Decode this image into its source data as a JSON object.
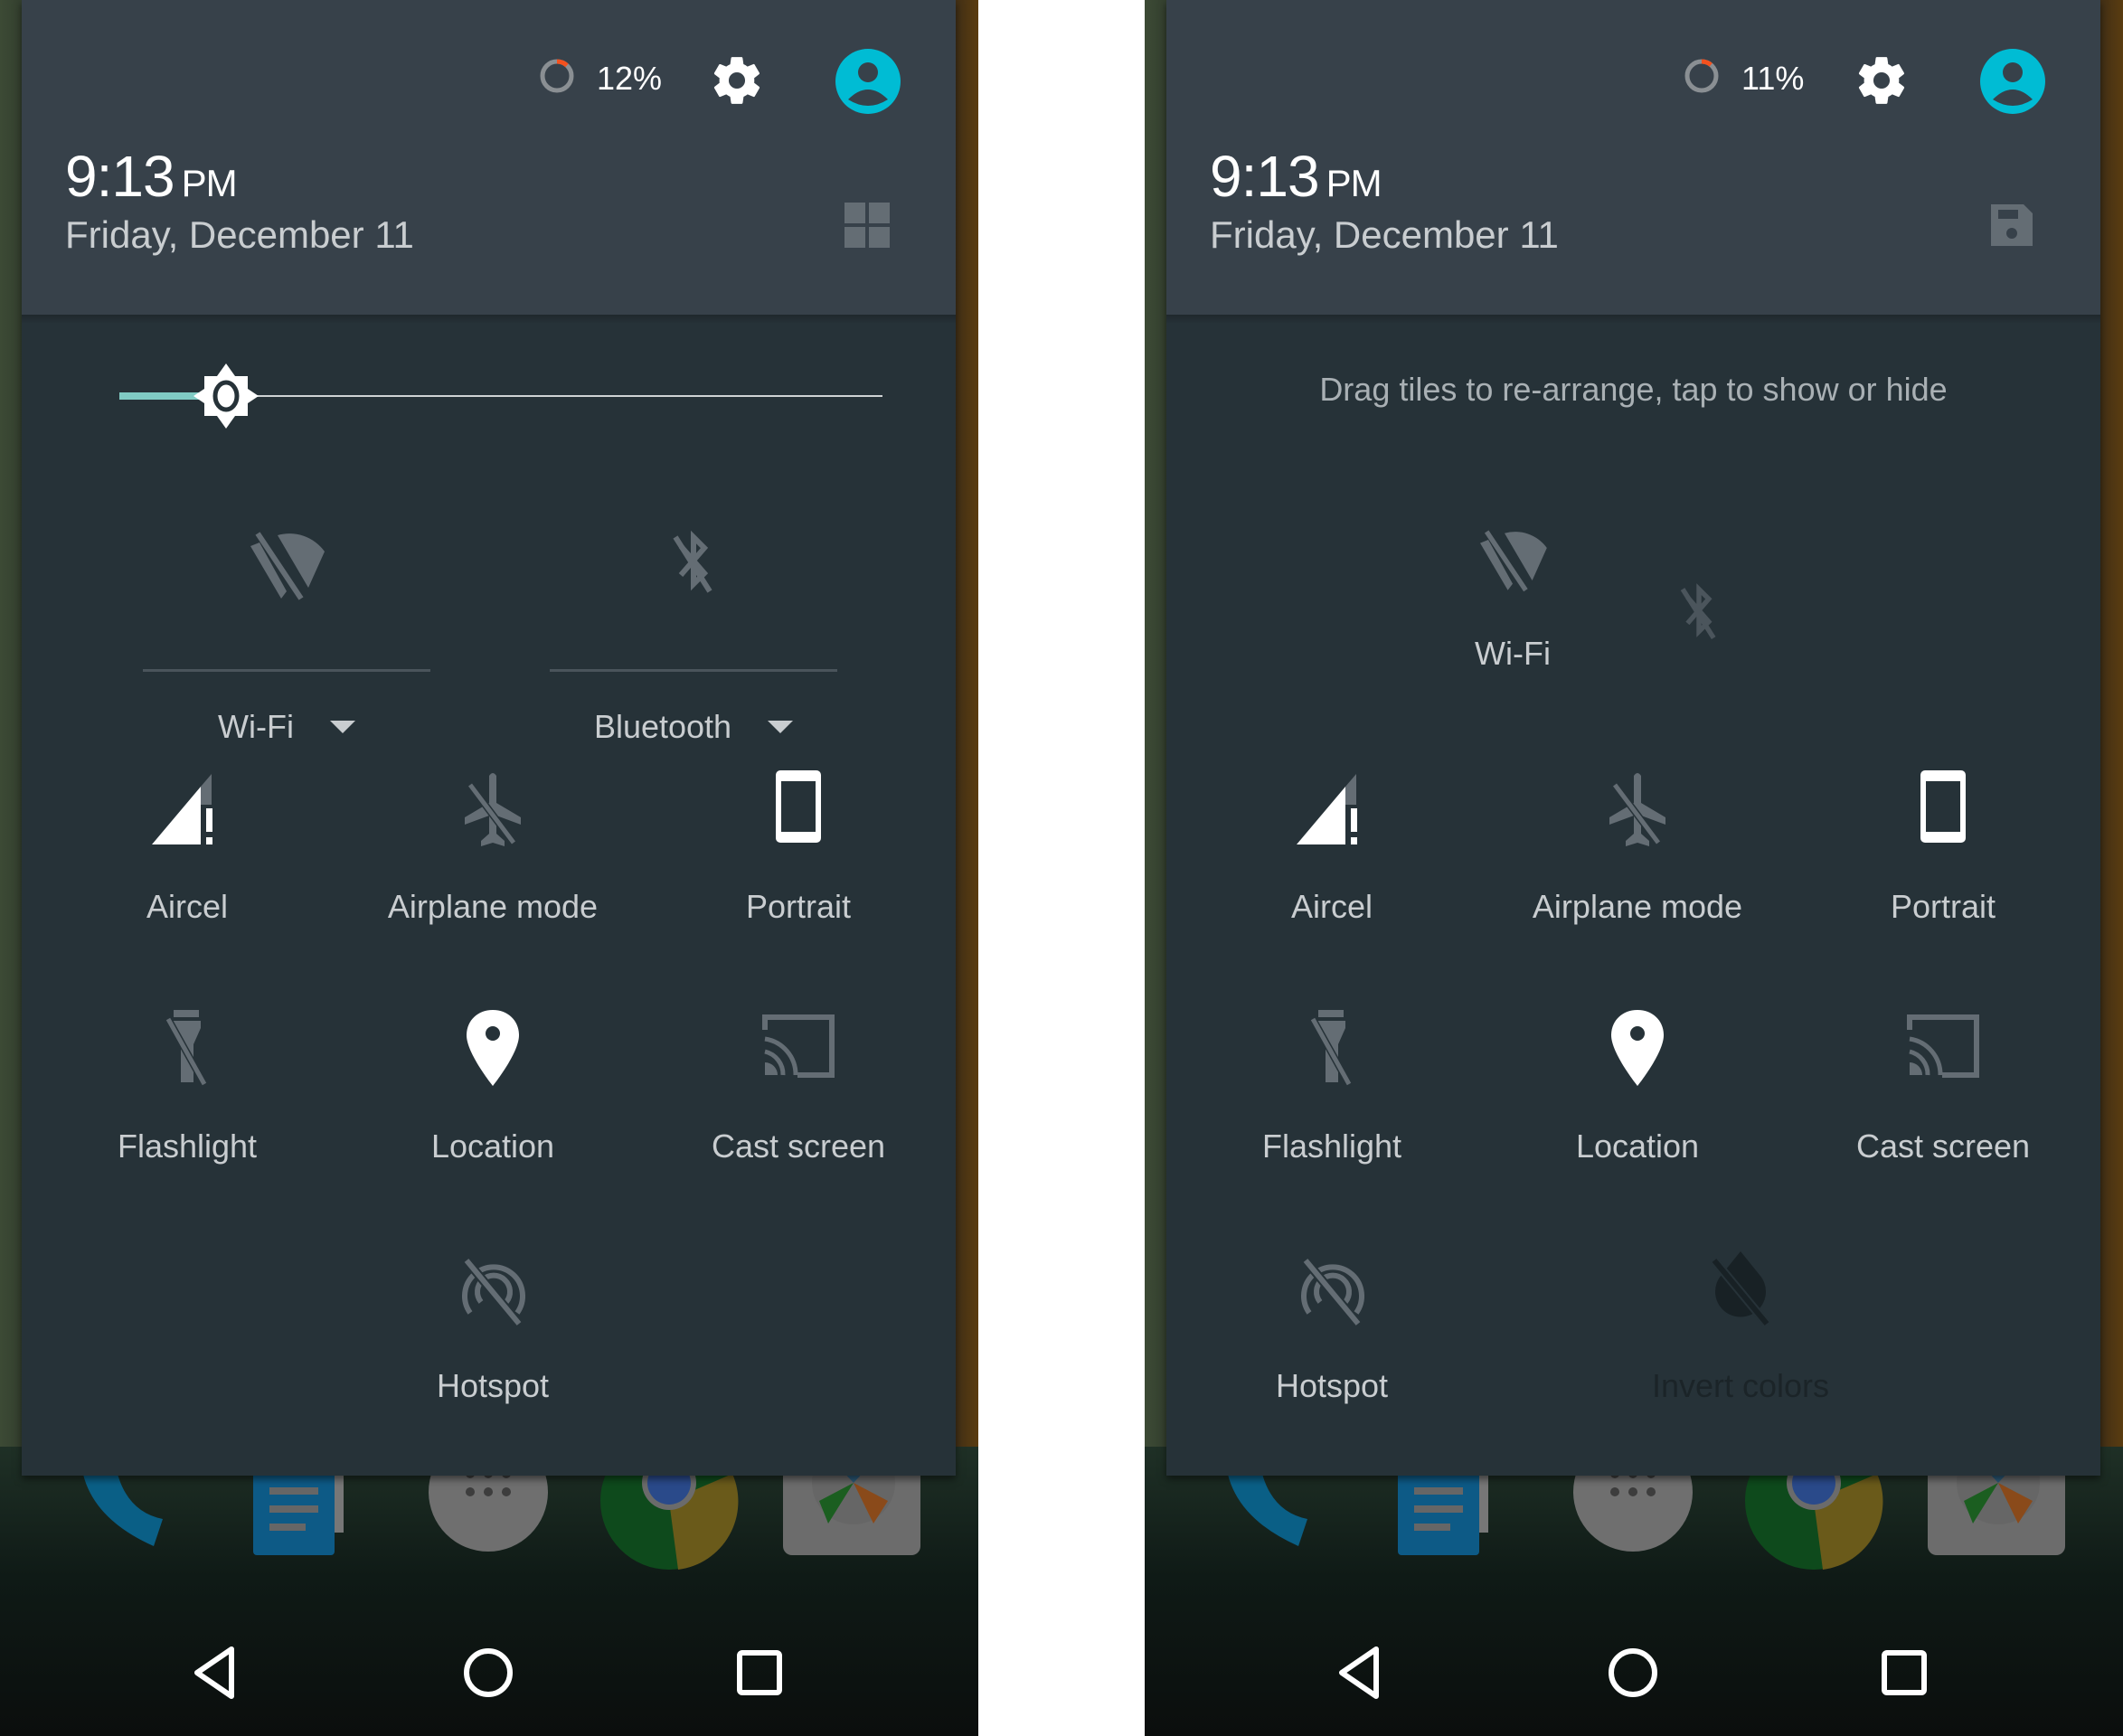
{
  "screens": [
    {
      "id": "left",
      "mode": "normal",
      "battery": {
        "percent_label": "12%",
        "level": 0.12
      },
      "time": {
        "value": "9:13",
        "ampm": "PM"
      },
      "date": "Friday, December 11",
      "header_action_icon": "grid-icon",
      "brightness": {
        "level": 0.14
      },
      "expandable_tiles": [
        {
          "label": "Wi-Fi",
          "icon": "wifi-off-icon"
        },
        {
          "label": "Bluetooth",
          "icon": "bluetooth-off-icon"
        }
      ],
      "tiles": [
        {
          "label": "Aircel",
          "icon": "signal-alert-icon",
          "active": true
        },
        {
          "label": "Airplane mode",
          "icon": "airplane-off-icon",
          "active": false
        },
        {
          "label": "Portrait",
          "icon": "portrait-icon",
          "active": true
        },
        {
          "label": "Flashlight",
          "icon": "flashlight-off-icon",
          "active": false
        },
        {
          "label": "Location",
          "icon": "location-icon",
          "active": true
        },
        {
          "label": "Cast screen",
          "icon": "cast-icon",
          "active": false
        },
        {
          "label": "Hotspot",
          "icon": "hotspot-off-icon",
          "active": false
        }
      ]
    },
    {
      "id": "right",
      "mode": "edit",
      "battery": {
        "percent_label": "11%",
        "level": 0.11
      },
      "time": {
        "value": "9:13",
        "ampm": "PM"
      },
      "date": "Friday, December 11",
      "header_action_icon": "save-icon",
      "hint": "Drag tiles to re-arrange, tap to show or hide",
      "tiles": [
        {
          "label": "Wi-Fi",
          "icon": "wifi-off-icon",
          "active": false
        },
        {
          "label": "",
          "icon": "bluetooth-off-icon",
          "active": false,
          "dragging": true
        },
        {
          "label": "Aircel",
          "icon": "signal-alert-icon",
          "active": true
        },
        {
          "label": "Airplane mode",
          "icon": "airplane-off-icon",
          "active": false
        },
        {
          "label": "Portrait",
          "icon": "portrait-icon",
          "active": true
        },
        {
          "label": "Flashlight",
          "icon": "flashlight-off-icon",
          "active": false
        },
        {
          "label": "Location",
          "icon": "location-icon",
          "active": true
        },
        {
          "label": "Cast screen",
          "icon": "cast-icon",
          "active": false
        },
        {
          "label": "Hotspot",
          "icon": "hotspot-off-icon",
          "active": false
        },
        {
          "label": "Invert colors",
          "icon": "invert-colors-off-icon",
          "active": false,
          "hidden": true
        }
      ]
    }
  ],
  "dock_apps": [
    "phone",
    "docs",
    "app-drawer",
    "chrome",
    "camera"
  ],
  "nav": [
    "back",
    "home",
    "recents"
  ],
  "colors": {
    "accent": "#00bcd4",
    "slider": "#80cbc4",
    "battery_low": "#f4511e",
    "header": "#37414a",
    "panel": "#263238",
    "icon_inactive": "#646d74"
  }
}
